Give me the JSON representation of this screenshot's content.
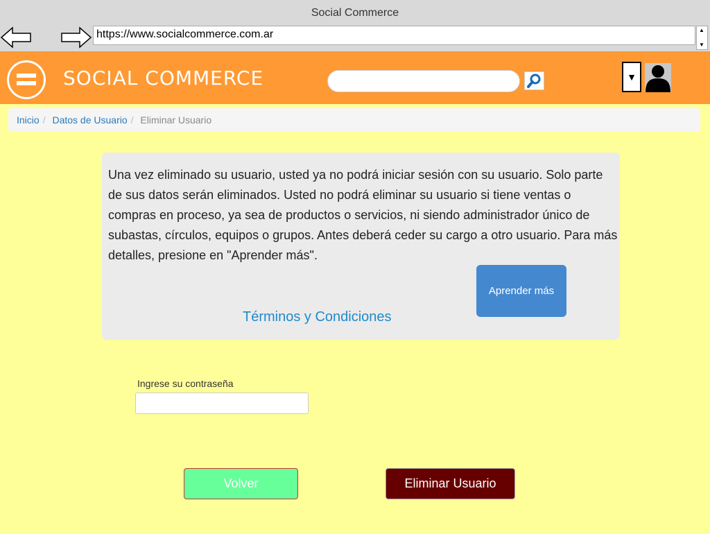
{
  "window": {
    "title": "Social Commerce"
  },
  "browser": {
    "url": "https://www.socialcommerce.com.ar",
    "back_icon": "arrow-left-icon",
    "forward_icon": "arrow-right-icon"
  },
  "header": {
    "brand": "SOCIAL COMMERCE",
    "search_placeholder": "",
    "menu_icon": "hamburger-icon",
    "search_icon": "magnifier-icon",
    "dropdown_icon": "triangle-down-icon",
    "avatar_icon": "user-silhouette-icon",
    "bg_color": "#ff9933"
  },
  "breadcrumb": {
    "items": [
      "Inicio",
      "Datos de Usuario"
    ],
    "current": "Eliminar Usuario",
    "separator": "/"
  },
  "info": {
    "text": "Una vez eliminado su usuario, usted ya no podrá iniciar sesión con su usuario. Solo parte de sus datos serán eliminados. Usted no podrá eliminar su usuario si tiene ventas o compras en proceso, ya sea de productos o servicios, ni siendo administrador único de subastas, círculos, equipos o grupos. Antes deberá ceder su cargo a otro usuario. Para más detalles, presione en \"Aprender más\".",
    "learn_more": "Aprender más",
    "terms": "Términos y Condiciones"
  },
  "password": {
    "label": "Ingrese su contraseña",
    "value": ""
  },
  "actions": {
    "back": "Volver",
    "delete": "Eliminar Usuario"
  },
  "colors": {
    "page_bg": "#ffff99",
    "back_button": "#66ff99",
    "delete_button": "#660000",
    "learn_button": "#4489d0",
    "link": "#1f8acb"
  }
}
